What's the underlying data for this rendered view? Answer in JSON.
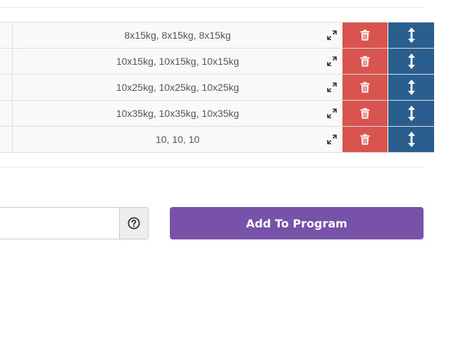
{
  "table": {
    "rows": [
      {
        "sets": "8x15kg, 8x15kg, 8x15kg"
      },
      {
        "sets": "10x15kg, 10x15kg, 10x15kg"
      },
      {
        "sets": "10x25kg, 10x25kg, 10x25kg"
      },
      {
        "sets": "10x35kg, 10x35kg, 10x35kg"
      },
      {
        "sets": "10, 10, 10"
      }
    ],
    "icons": {
      "expand": "expand-icon",
      "delete": "trash-icon",
      "sort": "vertical-arrows-icon"
    }
  },
  "footer": {
    "input_value": "",
    "help_icon": "question-circle-icon",
    "add_button_label": "Add To Program"
  },
  "colors": {
    "delete": "#d9534f",
    "sort": "#295e8f",
    "add_button": "#7851a9"
  }
}
